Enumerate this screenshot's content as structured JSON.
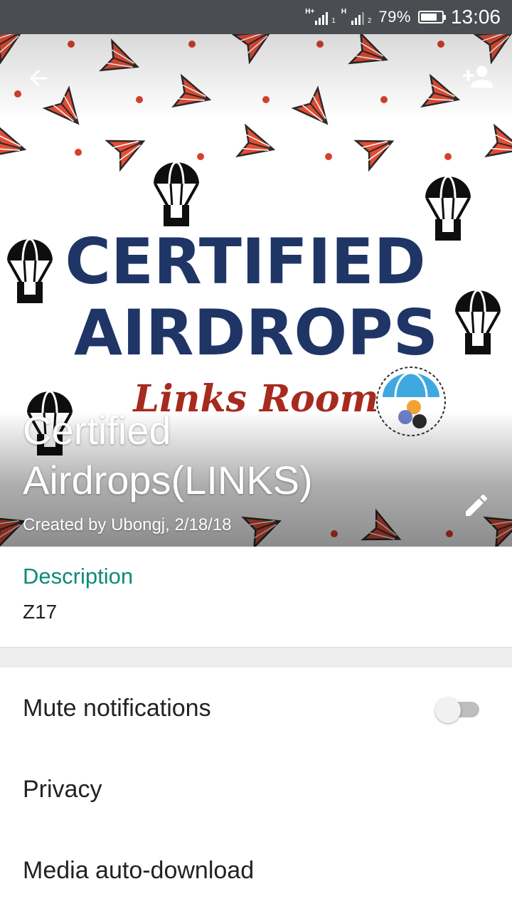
{
  "status_bar": {
    "sim1_network": "H+",
    "sim1_index": "1",
    "sim2_network": "H",
    "sim2_index": "2",
    "battery_percent": "79%",
    "battery_level": 0.79,
    "time": "13:06"
  },
  "header": {
    "picture": {
      "title_line1": "CERTIFIED",
      "title_line2": "AIRDROPS",
      "subtitle": "Links Room",
      "title_color": "#1f3566",
      "subtitle_color": "#a72a1f",
      "plane_color": "#e34d35"
    },
    "group_name": "Certified Airdrops(LINKS)",
    "created_by": "Created by Ubongj, 2/18/18",
    "back_icon": "arrow-back-icon",
    "add_participant_icon": "person-add-icon",
    "edit_icon": "pencil-icon"
  },
  "description": {
    "label": "Description",
    "value": "Z17"
  },
  "settings": {
    "mute_label": "Mute notifications",
    "mute_enabled": false,
    "privacy_label": "Privacy",
    "media_label": "Media auto-download"
  },
  "colors": {
    "accent": "#0b8a78",
    "status_bar": "#4a4d51"
  }
}
